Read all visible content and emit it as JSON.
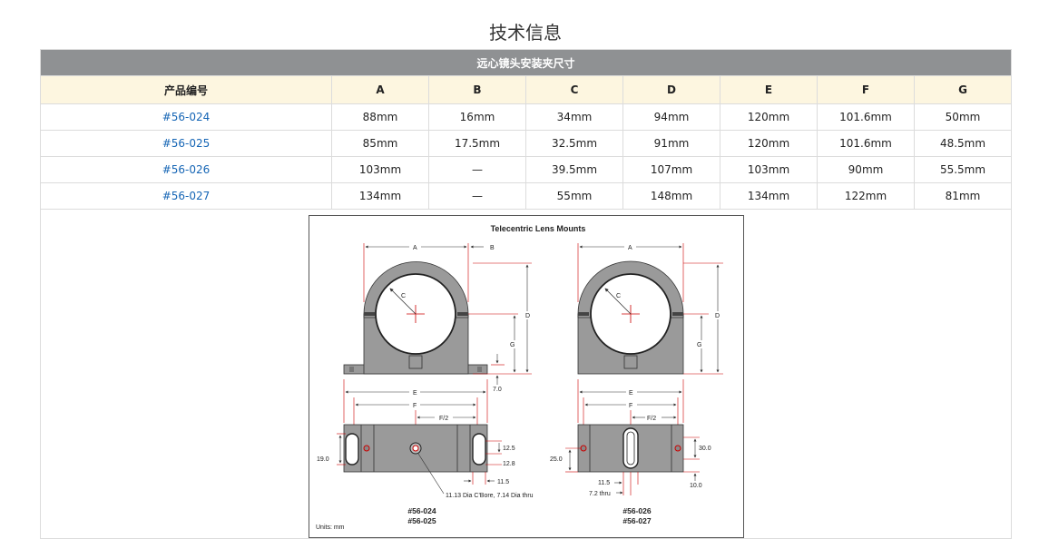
{
  "title": "技术信息",
  "table": {
    "caption": "远心镜头安装夹尺寸",
    "columns": [
      "产品编号",
      "A",
      "B",
      "C",
      "D",
      "E",
      "F",
      "G"
    ],
    "rows": [
      {
        "pn": "#56-024",
        "a": "88mm",
        "b": "16mm",
        "c": "34mm",
        "d": "94mm",
        "e": "120mm",
        "f": "101.6mm",
        "g": "50mm"
      },
      {
        "pn": "#56-025",
        "a": "85mm",
        "b": "17.5mm",
        "c": "32.5mm",
        "d": "91mm",
        "e": "120mm",
        "f": "101.6mm",
        "g": "48.5mm"
      },
      {
        "pn": "#56-026",
        "a": "103mm",
        "b": "—",
        "c": "39.5mm",
        "d": "107mm",
        "e": "103mm",
        "f": "90mm",
        "g": "55.5mm"
      },
      {
        "pn": "#56-027",
        "a": "134mm",
        "b": "—",
        "c": "55mm",
        "d": "148mm",
        "e": "134mm",
        "f": "122mm",
        "g": "81mm"
      }
    ]
  },
  "drawing": {
    "title": "Telecentric Lens Mounts",
    "labels": {
      "a": "A",
      "b": "B",
      "c": "C",
      "d": "D",
      "e": "E",
      "f": "F",
      "f2": "F/2",
      "g": "G",
      "dim_7_0": "7.0",
      "dim_19_0": "19.0",
      "dim_12_5": "12.5",
      "dim_12_8": "12.8",
      "dim_11_5": "11.5",
      "dim_25_0": "25.0",
      "dim_30_0": "30.0",
      "dim_10_0": "10.0",
      "dim_7_2": "7.2 thru",
      "cbore_note": "11.13 Dia C'Bore, 7.14 Dia thru"
    },
    "left_parts": [
      "#56-024",
      "#56-025"
    ],
    "right_parts": [
      "#56-026",
      "#56-027"
    ],
    "units": "Units: mm"
  }
}
